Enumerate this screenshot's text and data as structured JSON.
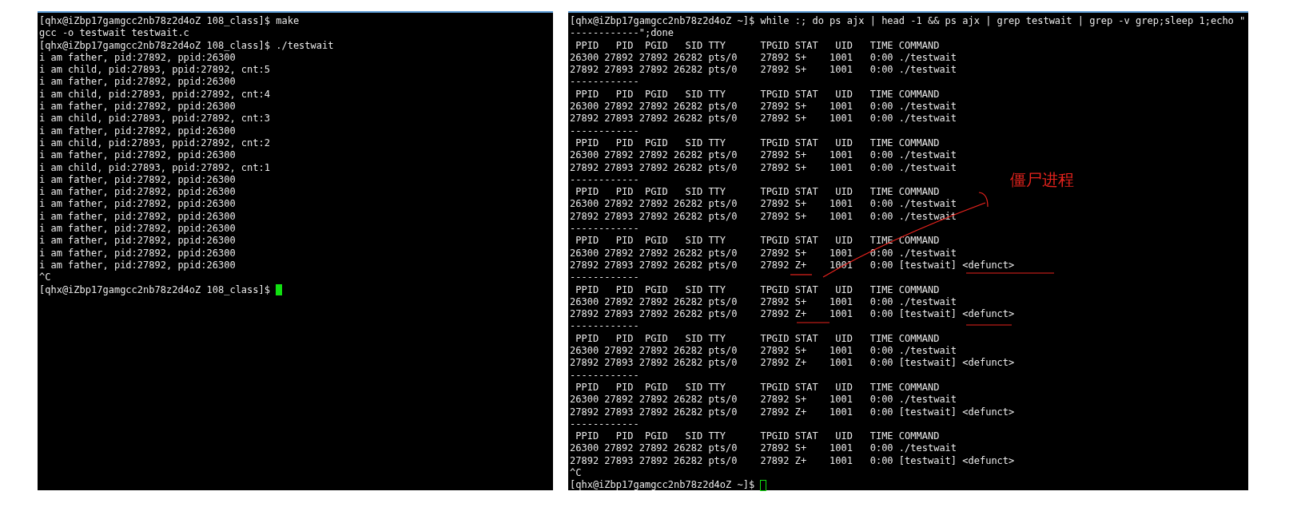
{
  "terminals": [
    {
      "focused": true,
      "lines": [
        "[qhx@iZbp17gamgcc2nb78z2d4oZ 108_class]$ make",
        "gcc -o testwait testwait.c",
        "[qhx@iZbp17gamgcc2nb78z2d4oZ 108_class]$ ./testwait",
        "i am father, pid:27892, ppid:26300",
        "i am child, pid:27893, ppid:27892, cnt:5",
        "i am father, pid:27892, ppid:26300",
        "i am child, pid:27893, ppid:27892, cnt:4",
        "i am father, pid:27892, ppid:26300",
        "i am child, pid:27893, ppid:27892, cnt:3",
        "i am father, pid:27892, ppid:26300",
        "i am child, pid:27893, ppid:27892, cnt:2",
        "i am father, pid:27892, ppid:26300",
        "i am child, pid:27893, ppid:27892, cnt:1",
        "i am father, pid:27892, ppid:26300",
        "i am father, pid:27892, ppid:26300",
        "i am father, pid:27892, ppid:26300",
        "i am father, pid:27892, ppid:26300",
        "i am father, pid:27892, ppid:26300",
        "i am father, pid:27892, ppid:26300",
        "i am father, pid:27892, ppid:26300",
        "i am father, pid:27892, ppid:26300",
        "^C"
      ],
      "prompt": "[qhx@iZbp17gamgcc2nb78z2d4oZ 108_class]$ "
    },
    {
      "focused": false,
      "lines": [
        "[qhx@iZbp17gamgcc2nb78z2d4oZ ~]$ while :; do ps ajx | head -1 && ps ajx | grep testwait | grep -v grep;sleep 1;echo \"",
        "------------\";done",
        " PPID   PID  PGID   SID TTY      TPGID STAT   UID   TIME COMMAND",
        "26300 27892 27892 26282 pts/0    27892 S+    1001   0:00 ./testwait",
        "27892 27893 27892 26282 pts/0    27892 S+    1001   0:00 ./testwait",
        "------------",
        " PPID   PID  PGID   SID TTY      TPGID STAT   UID   TIME COMMAND",
        "26300 27892 27892 26282 pts/0    27892 S+    1001   0:00 ./testwait",
        "27892 27893 27892 26282 pts/0    27892 S+    1001   0:00 ./testwait",
        "------------",
        " PPID   PID  PGID   SID TTY      TPGID STAT   UID   TIME COMMAND",
        "26300 27892 27892 26282 pts/0    27892 S+    1001   0:00 ./testwait",
        "27892 27893 27892 26282 pts/0    27892 S+    1001   0:00 ./testwait",
        "------------",
        " PPID   PID  PGID   SID TTY      TPGID STAT   UID   TIME COMMAND",
        "26300 27892 27892 26282 pts/0    27892 S+    1001   0:00 ./testwait",
        "27892 27893 27892 26282 pts/0    27892 S+    1001   0:00 ./testwait",
        "------------",
        " PPID   PID  PGID   SID TTY      TPGID STAT   UID   TIME COMMAND",
        "26300 27892 27892 26282 pts/0    27892 S+    1001   0:00 ./testwait",
        "27892 27893 27892 26282 pts/0    27892 Z+    1001   0:00 [testwait] <defunct>",
        "------------",
        " PPID   PID  PGID   SID TTY      TPGID STAT   UID   TIME COMMAND",
        "26300 27892 27892 26282 pts/0    27892 S+    1001   0:00 ./testwait",
        "27892 27893 27892 26282 pts/0    27892 Z+    1001   0:00 [testwait] <defunct>",
        "------------",
        " PPID   PID  PGID   SID TTY      TPGID STAT   UID   TIME COMMAND",
        "26300 27892 27892 26282 pts/0    27892 S+    1001   0:00 ./testwait",
        "27892 27893 27892 26282 pts/0    27892 Z+    1001   0:00 [testwait] <defunct>",
        "------------",
        " PPID   PID  PGID   SID TTY      TPGID STAT   UID   TIME COMMAND",
        "26300 27892 27892 26282 pts/0    27892 S+    1001   0:00 ./testwait",
        "27892 27893 27892 26282 pts/0    27892 Z+    1001   0:00 [testwait] <defunct>",
        "------------",
        " PPID   PID  PGID   SID TTY      TPGID STAT   UID   TIME COMMAND",
        "26300 27892 27892 26282 pts/0    27892 S+    1001   0:00 ./testwait",
        "27892 27893 27892 26282 pts/0    27892 Z+    1001   0:00 [testwait] <defunct>",
        "^C"
      ],
      "prompt": "[qhx@iZbp17gamgcc2nb78z2d4oZ ~]$ "
    }
  ],
  "annotation": {
    "label": "僵尸进程"
  }
}
